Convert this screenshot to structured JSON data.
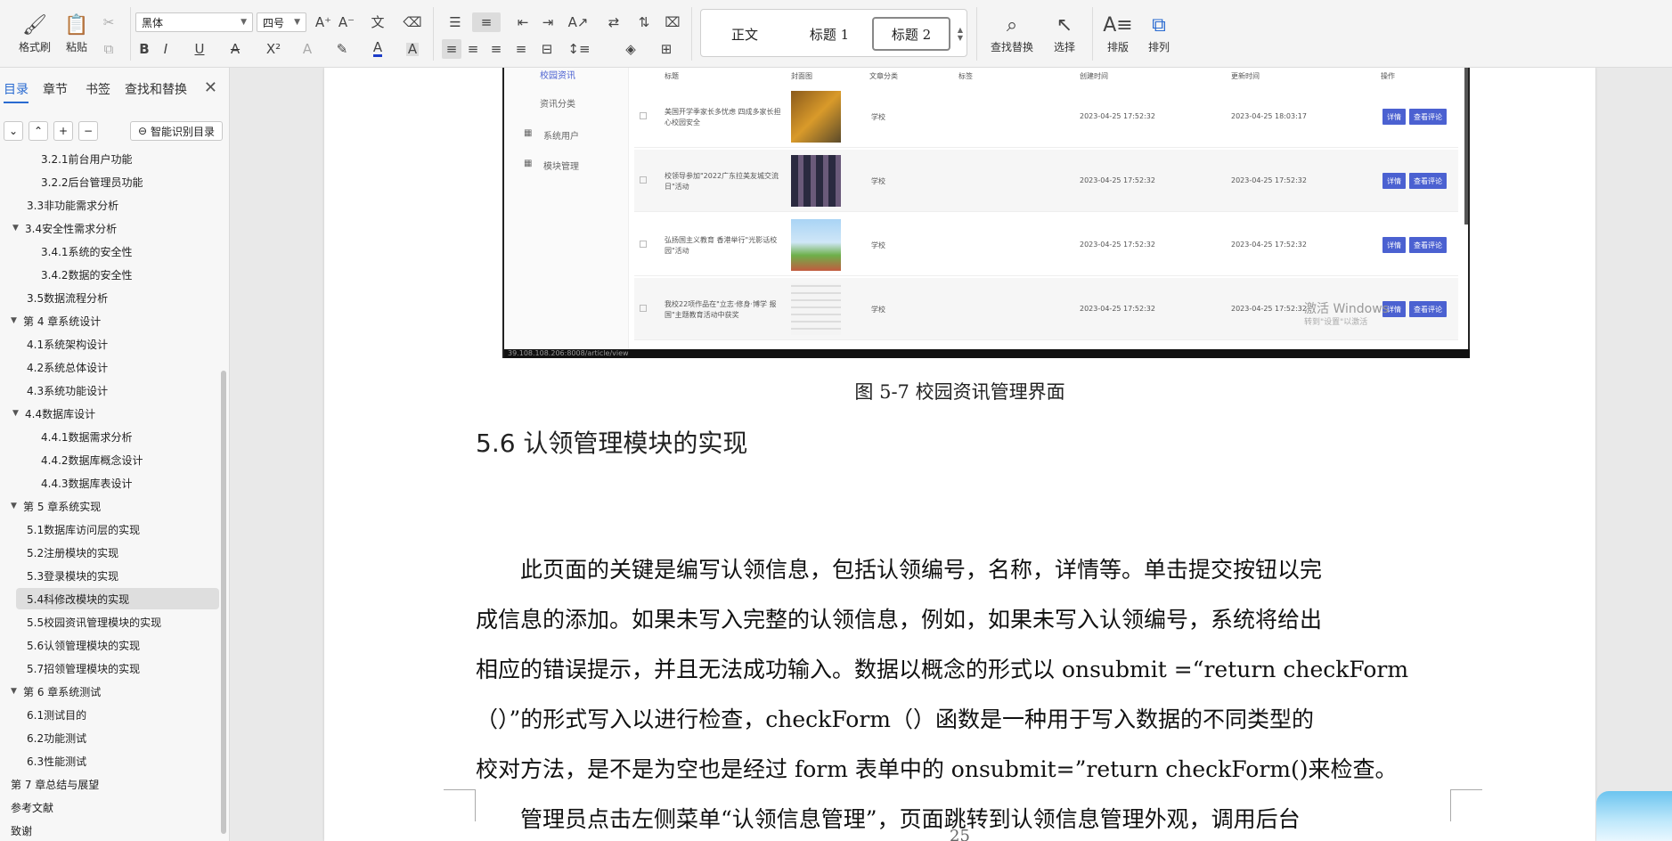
{
  "ribbon": {
    "format_painter": "格式刷",
    "paste": "粘贴",
    "font_name": "黑体",
    "font_size": "四号",
    "styles": [
      "正文",
      "标题 1",
      "标题 2"
    ],
    "find_replace": "查找替换",
    "select": "选择",
    "layout": "排版",
    "arrange": "排列"
  },
  "nav": {
    "tabs": [
      "目录",
      "章节",
      "书签",
      "查找和替换"
    ],
    "smart_toc": "智能识别目录",
    "toc": [
      {
        "label": "3.2.1前台用户功能",
        "level": 3
      },
      {
        "label": "3.2.2后台管理员功能",
        "level": 3
      },
      {
        "label": "3.3非功能需求分析",
        "level": 2
      },
      {
        "label": "3.4安全性需求分析",
        "level": 2,
        "expanded": true
      },
      {
        "label": "3.4.1系统的安全性",
        "level": 3
      },
      {
        "label": "3.4.2数据的安全性",
        "level": 3
      },
      {
        "label": "3.5数据流程分析",
        "level": 2
      },
      {
        "label": "第 4 章系统设计",
        "level": 1,
        "expanded": true
      },
      {
        "label": "4.1系统架构设计",
        "level": 2
      },
      {
        "label": "4.2系统总体设计",
        "level": 2
      },
      {
        "label": "4.3系统功能设计",
        "level": 2
      },
      {
        "label": "4.4数据库设计",
        "level": 2,
        "expanded": true
      },
      {
        "label": "4.4.1数据需求分析",
        "level": 3
      },
      {
        "label": "4.4.2数据库概念设计",
        "level": 3
      },
      {
        "label": "4.4.3数据库表设计",
        "level": 3
      },
      {
        "label": "第 5 章系统实现",
        "level": 1,
        "expanded": true
      },
      {
        "label": "5.1数据库访问层的实现",
        "level": 2
      },
      {
        "label": "5.2注册模块的实现",
        "level": 2
      },
      {
        "label": "5.3登录模块的实现",
        "level": 2
      },
      {
        "label": "5.4科修改模块的实现",
        "level": 2,
        "highlighted": true
      },
      {
        "label": "5.5校园资讯管理模块的实现",
        "level": 2
      },
      {
        "label": "5.6认领管理模块的实现",
        "level": 2
      },
      {
        "label": "5.7招领管理模块的实现",
        "level": 2
      },
      {
        "label": "第 6 章系统测试",
        "level": 1,
        "expanded": true
      },
      {
        "label": "6.1测试目的",
        "level": 2
      },
      {
        "label": "6.2功能测试",
        "level": 2
      },
      {
        "label": "6.3性能测试",
        "level": 2
      },
      {
        "label": "第 7 章总结与展望",
        "level": 1
      },
      {
        "label": "参考文献",
        "level": 1
      },
      {
        "label": "致谢",
        "level": 1
      }
    ]
  },
  "figure": {
    "side_items": [
      "校园资讯",
      "资讯分类",
      "系统用户",
      "模块管理"
    ],
    "headers": [
      "标题",
      "封面图",
      "文章分类",
      "标签",
      "创建时间",
      "更新时间",
      "操作"
    ],
    "rows": [
      {
        "title_l1": "美国开学季家长多忧虑 四成多家长担",
        "title_l2": "心校园安全",
        "category": "学校",
        "created": "2023-04-25 17:52:32",
        "updated": "2023-04-25 18:03:17"
      },
      {
        "title_l1": "校领导参加\"2022广东拉美友城交流",
        "title_l2": "日\"活动",
        "category": "学校",
        "created": "2023-04-25 17:52:32",
        "updated": "2023-04-25 17:52:32"
      },
      {
        "title_l1": "弘扬国主义教育 香港举行\"光影话校",
        "title_l2": "园\"活动",
        "category": "学校",
        "created": "2023-04-25 17:52:32",
        "updated": "2023-04-25 17:52:32"
      },
      {
        "title_l1": "我校22项作品在\"立志·修身·博学 报",
        "title_l2": "国\"主题教育活动中获奖",
        "category": "学校",
        "created": "2023-04-25 17:52:32",
        "updated": "2023-04-25 17:52:32"
      }
    ],
    "btn_detail": "详情",
    "btn_review": "查看评论",
    "url": "39.108.108.206:8008/article/view",
    "watermark": "激活 Windows",
    "watermark_sub": "转到\"设置\"以激活"
  },
  "document": {
    "caption": "图 5-7 校园资讯管理界面",
    "heading": "5.6  认领管理模块的实现",
    "p1_lines": [
      "　　此页面的关键是编写认领信息，包括认领编号，名称，详情等。单击提交按钮以完",
      "成信息的添加。如果未写入完整的认领信息，例如，如果未写入认领编号，系统将给出",
      "相应的错误提示，并且无法成功输入。数据以概念的形式以 onsubmit =“return checkForm",
      "（）”的形式写入以进行检查，checkForm（）函数是一种用于写入数据的不同类型的",
      "校对方法，是不是为空也是经过 form 表单中的 onsubmit=”return checkForm()来检查。"
    ],
    "p2_line": "　　管理员点击左侧菜单“认领信息管理”，页面跳转到认领信息管理外观，调用后台",
    "page_number": "25"
  }
}
